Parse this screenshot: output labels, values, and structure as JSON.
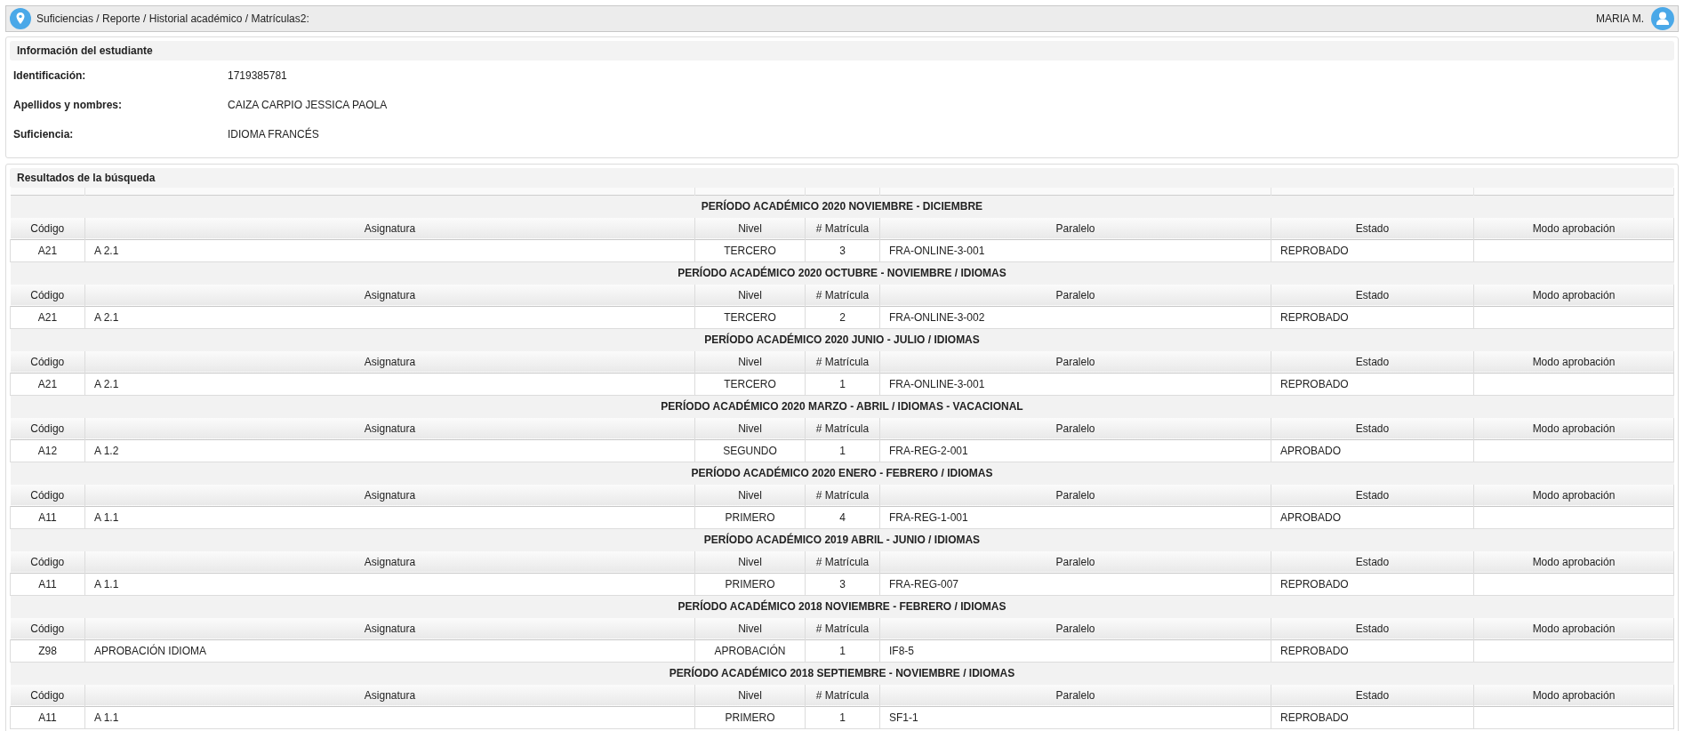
{
  "breadcrumb": "Suficiencias / Reporte / Historial académico / Matrículas2:",
  "user": {
    "name": "MARIA M."
  },
  "student_info": {
    "title": "Información del estudiante",
    "fields": [
      {
        "label": "Identificación:",
        "value": "1719385781"
      },
      {
        "label": "Apellidos y nombres:",
        "value": "CAIZA CARPIO JESSICA PAOLA"
      },
      {
        "label": "Suficiencia:",
        "value": "IDIOMA FRANCÉS"
      }
    ]
  },
  "results": {
    "title": "Resultados de la búsqueda",
    "periods": [
      {
        "title": "PERÍODO ACADÉMICO 2020 NOVIEMBRE - DICIEMBRE",
        "columns": [
          "Código",
          "Asignatura",
          "Nivel",
          "# Matrícula",
          "Paralelo",
          "Estado",
          "Modo aprobación"
        ],
        "rows": [
          [
            "A21",
            "A 2.1",
            "TERCERO",
            "3",
            "FRA-ONLINE-3-001",
            "REPROBADO"
          ]
        ]
      },
      {
        "title": "PERÍODO ACADÉMICO 2020 OCTUBRE - NOVIEMBRE / IDIOMAS",
        "columns": [
          "Código",
          "Asignatura",
          "Nivel",
          "# Matrícula",
          "Paralelo",
          "Estado",
          "Modo aprobación"
        ],
        "rows": [
          [
            "A21",
            "A 2.1",
            "TERCERO",
            "2",
            "FRA-ONLINE-3-002",
            "REPROBADO"
          ]
        ]
      },
      {
        "title": "PERÍODO ACADÉMICO 2020 JUNIO - JULIO / IDIOMAS",
        "columns": [
          "Código",
          "Asignatura",
          "Nivel",
          "# Matrícula",
          "Paralelo",
          "Estado",
          "Modo aprobación"
        ],
        "rows": [
          [
            "A21",
            "A 2.1",
            "TERCERO",
            "1",
            "FRA-ONLINE-3-001",
            "REPROBADO"
          ]
        ]
      },
      {
        "title": "PERÍODO ACADÉMICO 2020 MARZO - ABRIL / IDIOMAS - VACACIONAL",
        "columns": [
          "Código",
          "Asignatura",
          "Nivel",
          "# Matrícula",
          "Paralelo",
          "Estado",
          "Modo aprobación"
        ],
        "rows": [
          [
            "A12",
            "A 1.2",
            "SEGUNDO",
            "1",
            "FRA-REG-2-001",
            "APROBADO"
          ]
        ]
      },
      {
        "title": "PERÍODO ACADÉMICO 2020 ENERO - FEBRERO / IDIOMAS",
        "columns": [
          "Código",
          "Asignatura",
          "Nivel",
          "# Matrícula",
          "Paralelo",
          "Estado",
          "Modo aprobación"
        ],
        "rows": [
          [
            "A11",
            "A 1.1",
            "PRIMERO",
            "4",
            "FRA-REG-1-001",
            "APROBADO"
          ]
        ]
      },
      {
        "title": "PERÍODO ACADÉMICO 2019 ABRIL - JUNIO / IDIOMAS",
        "columns": [
          "Código",
          "Asignatura",
          "Nivel",
          "# Matrícula",
          "Paralelo",
          "Estado",
          "Modo aprobación"
        ],
        "rows": [
          [
            "A11",
            "A 1.1",
            "PRIMERO",
            "3",
            "FRA-REG-007",
            "REPROBADO"
          ]
        ]
      },
      {
        "title": "PERÍODO ACADÉMICO 2018 NOVIEMBRE - FEBRERO / IDIOMAS",
        "columns": [
          "Código",
          "Asignatura",
          "Nivel",
          "# Matrícula",
          "Paralelo",
          "Estado",
          "Modo aprobación"
        ],
        "rows": [
          [
            "Z98",
            "APROBACIÓN IDIOMA",
            "APROBACIÓN",
            "1",
            "IF8-5",
            "REPROBADO"
          ]
        ]
      },
      {
        "title": "PERÍODO ACADÉMICO 2018 SEPTIEMBRE - NOVIEMBRE / IDIOMAS",
        "columns": [
          "Código",
          "Asignatura",
          "Nivel",
          "# Matrícula",
          "Paralelo",
          "Estado",
          "Modo aprobación"
        ],
        "rows": [
          [
            "A11",
            "A 1.1",
            "PRIMERO",
            "1",
            "SF1-1",
            "REPROBADO"
          ]
        ]
      }
    ]
  }
}
